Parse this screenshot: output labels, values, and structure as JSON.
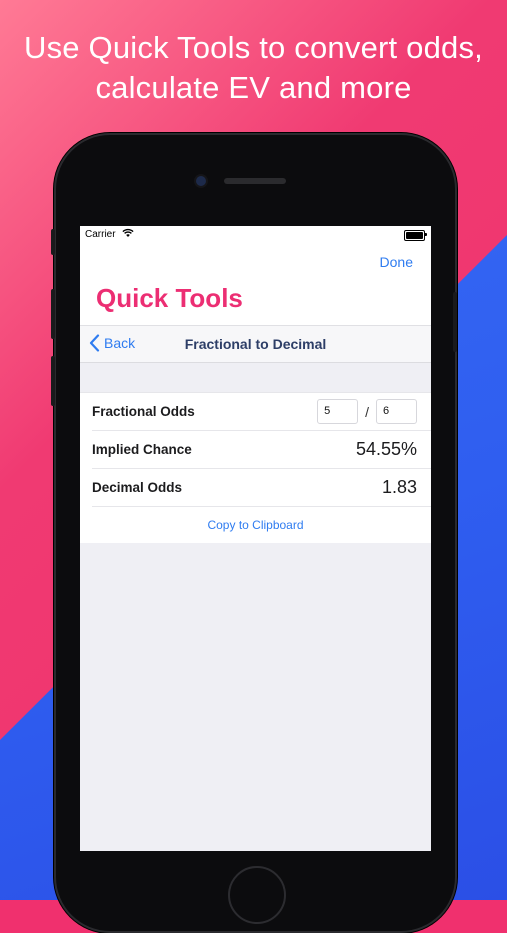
{
  "headline": {
    "line1": "Use Quick Tools to convert odds,",
    "line2": "calculate EV and more"
  },
  "status_bar": {
    "carrier": "Carrier"
  },
  "header": {
    "done_label": "Done",
    "title": "Quick Tools"
  },
  "nav": {
    "back_label": "Back",
    "title": "Fractional to Decimal"
  },
  "rows": {
    "fractional": {
      "label": "Fractional Odds",
      "numerator": "5",
      "separator": "/",
      "denominator": "6"
    },
    "implied": {
      "label": "Implied Chance",
      "value": "54.55%"
    },
    "decimal": {
      "label": "Decimal Odds",
      "value": "1.83"
    }
  },
  "copy_label": "Copy to Clipboard",
  "colors": {
    "accent_pink": "#ec2e73",
    "link_blue": "#2f7cf0",
    "nav_title": "#2d3e67"
  },
  "icons": [
    "wifi-icon",
    "battery-icon",
    "chevron-left-icon"
  ]
}
